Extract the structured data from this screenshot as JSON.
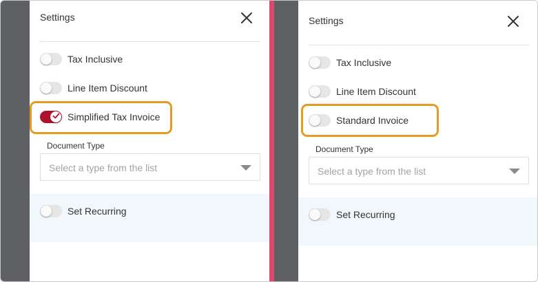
{
  "left_panel": {
    "title": "Settings",
    "toggles": [
      {
        "label": "Tax Inclusive",
        "on": false
      },
      {
        "label": "Line Item Discount",
        "on": false
      },
      {
        "label": "Simplified Tax Invoice",
        "on": true
      }
    ],
    "document_type": {
      "label": "Document Type",
      "placeholder": "Select a type from the list"
    },
    "recurring": {
      "label": "Set Recurring",
      "on": false
    }
  },
  "right_panel": {
    "title": "Settings",
    "toggles": [
      {
        "label": "Tax Inclusive",
        "on": false
      },
      {
        "label": "Line Item Discount",
        "on": false
      },
      {
        "label": "Standard Invoice",
        "on": false
      }
    ],
    "document_type": {
      "label": "Document Type",
      "placeholder": "Select a type from the list"
    },
    "recurring": {
      "label": "Set Recurring",
      "on": false
    }
  },
  "colors": {
    "divider": "#e0476c",
    "highlight": "#e69a1f",
    "toggle_on": "#b0122b",
    "recurring_bg": "#f1f8fc",
    "overlay": "#5f6063"
  },
  "icons": {
    "close": "close-icon",
    "check": "check-icon",
    "dropdown": "chevron-down-icon"
  }
}
